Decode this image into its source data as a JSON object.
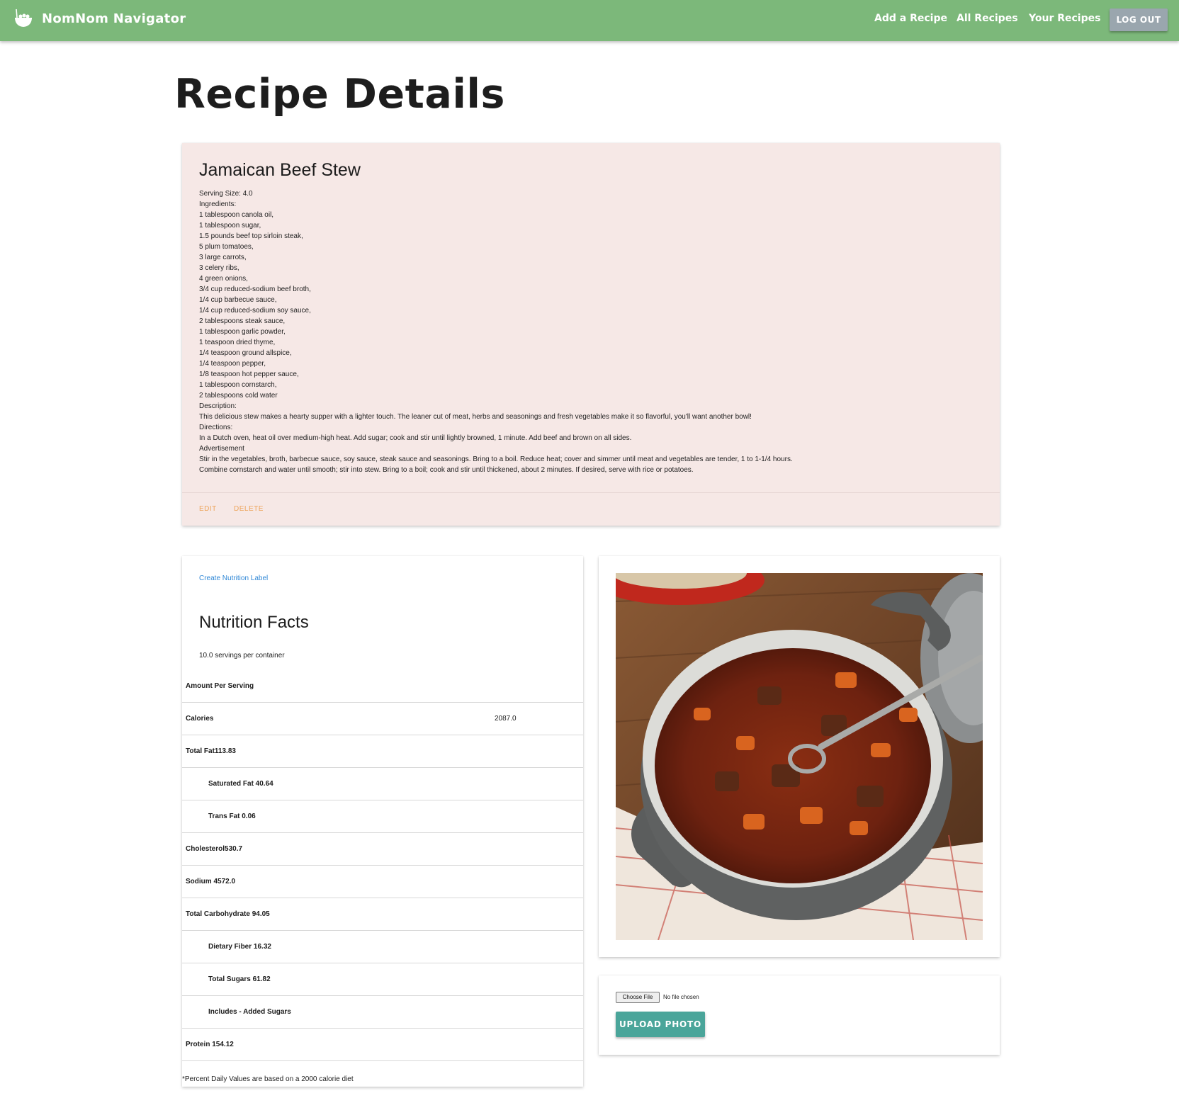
{
  "nav": {
    "brand": "NomNom Navigator",
    "links": [
      "Add a Recipe",
      "All Recipes",
      "Your Recipes"
    ],
    "logout": "LOG OUT",
    "color": "#7cb87a"
  },
  "page": {
    "title": "Recipe Details"
  },
  "recipe": {
    "name": "Jamaican Beef Stew",
    "lines": [
      "Serving Size: 4.0",
      "Ingredients:",
      "1 tablespoon canola oil,",
      "1 tablespoon sugar,",
      "1.5 pounds beef top sirloin steak,",
      "5 plum tomatoes,",
      "3 large carrots,",
      "3 celery ribs,",
      "4 green onions,",
      "3/4 cup reduced-sodium beef broth,",
      "1/4 cup barbecue sauce,",
      "1/4 cup reduced-sodium soy sauce,",
      "2 tablespoons steak sauce,",
      "1 tablespoon garlic powder,",
      "1 teaspoon dried thyme,",
      "1/4 teaspoon ground allspice,",
      "1/4 teaspoon pepper,",
      "1/8 teaspoon hot pepper sauce,",
      "1 tablespoon cornstarch,",
      "2 tablespoons cold water",
      "Description:",
      "This delicious stew makes a hearty supper with a lighter touch. The leaner cut of meat, herbs and seasonings and fresh vegetables make it so flavorful, you'll want another bowl!",
      "Directions:",
      "In a Dutch oven, heat oil over medium-high heat. Add sugar; cook and stir until lightly browned, 1 minute. Add beef and brown on all sides.",
      "Advertisement",
      "Stir in the vegetables, broth, barbecue sauce, soy sauce, steak sauce and seasonings. Bring to a boil. Reduce heat; cover and simmer until meat and vegetables are tender, 1 to 1-1/4 hours.",
      "Combine cornstarch and water until smooth; stir into stew. Bring to a boil; cook and stir until thickened, about 2 minutes. If desired, serve with rice or potatoes."
    ],
    "actions": {
      "edit": "EDIT",
      "delete": "DELETE"
    }
  },
  "nutrition": {
    "create_label": "Create Nutrition Label",
    "title": "Nutrition Facts",
    "servings": "10.0 servings per container",
    "rows": [
      {
        "label": "Amount Per Serving",
        "value": "",
        "indent": false
      },
      {
        "label": "Calories",
        "value": "2087.0",
        "indent": false
      },
      {
        "label": "Total Fat113.83",
        "value": "",
        "indent": false
      },
      {
        "label": "Saturated Fat 40.64",
        "value": "",
        "indent": true
      },
      {
        "label": "Trans Fat 0.06",
        "value": "",
        "indent": true
      },
      {
        "label": "Cholesterol530.7",
        "value": "",
        "indent": false
      },
      {
        "label": "Sodium 4572.0",
        "value": "",
        "indent": false
      },
      {
        "label": "Total Carbohydrate 94.05",
        "value": "",
        "indent": false
      },
      {
        "label": "Dietary Fiber 16.32",
        "value": "",
        "indent": true
      },
      {
        "label": "Total Sugars 61.82",
        "value": "",
        "indent": true
      },
      {
        "label": "Includes - Added Sugars",
        "value": "",
        "indent": true
      },
      {
        "label": "Protein 154.12",
        "value": "",
        "indent": false
      }
    ],
    "footnote": "*Percent Daily Values are based on a 2000 calorie diet"
  },
  "upload": {
    "choose_file": "Choose File",
    "no_file": "No file chosen",
    "button": "UPLOAD PHOTO",
    "button_color": "#4aa59a"
  }
}
